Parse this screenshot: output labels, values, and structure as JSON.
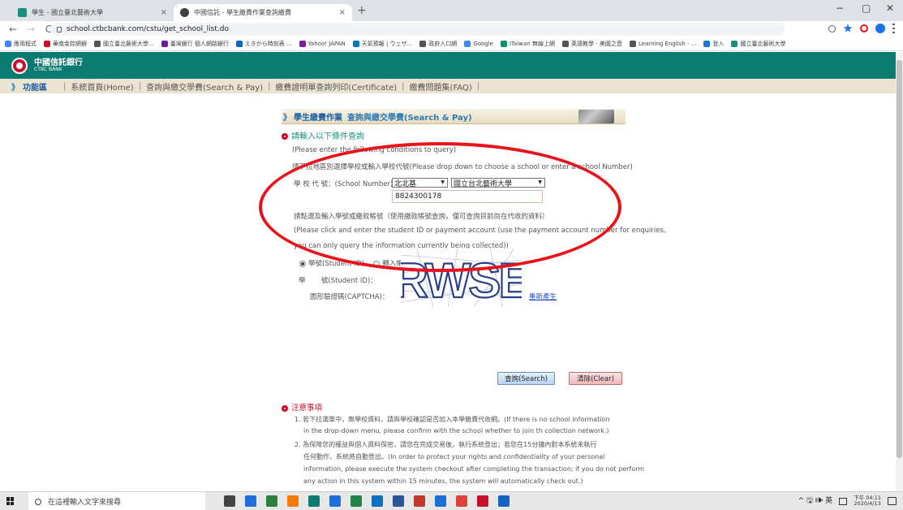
{
  "browser": {
    "tabs": [
      {
        "title": "學生 - 國立臺北藝術大學",
        "close": "×",
        "favicon_color": "#1a8f7a"
      },
      {
        "title": "中國信託 - 學生繳費作業查詢繳費",
        "close": "×",
        "favicon_color": "#3c4043"
      }
    ],
    "new_tab": "+",
    "window_controls": {
      "minimize": "−",
      "maximize": "▢",
      "close": "✕"
    },
    "nav": {
      "back": "←",
      "forward": "→",
      "reload": "C"
    },
    "url": "school.ctbcbank.com/cstu/get_school_list.do",
    "bookmarks": [
      {
        "label": "應用程式",
        "color": "#4285f4"
      },
      {
        "label": "華南金控網銀",
        "color": "#c8102e"
      },
      {
        "label": "國立臺北藝術大學...",
        "color": "#555555"
      },
      {
        "label": "臺灣銀行 個人網路銀行",
        "color": "#6a1b9a"
      },
      {
        "label": "えきから時刻表 ...",
        "color": "#1565c0"
      },
      {
        "label": "Yahoo! JAPAN",
        "color": "#7b1fa2"
      },
      {
        "label": "天氣預報 | ウェザ...",
        "color": "#0277bd"
      },
      {
        "label": "政府入口網",
        "color": "#555555"
      },
      {
        "label": "Google",
        "color": "#4285f4"
      },
      {
        "label": "iTaiwan 無線上網",
        "color": "#0a8f6f"
      },
      {
        "label": "英語教學 - 美國之音",
        "color": "#555555"
      },
      {
        "label": "Learning English - ...",
        "color": "#555555"
      },
      {
        "label": "登入",
        "color": "#1976d2"
      },
      {
        "label": "國立臺北藝術大學",
        "color": "#1a8f7a"
      }
    ],
    "more": "»"
  },
  "bank": {
    "name_cn": "中國信託銀行",
    "name_en": "CTBC BANK",
    "brand_color": "#0b7a70"
  },
  "menu": {
    "arrow": "》",
    "title": "功能區",
    "items": [
      "系統首頁(Home)",
      "查詢與繳交學費(Search & Pay)",
      "繳費證明單查詢列印(Certificate)",
      "繳費問題集(FAQ)"
    ],
    "separator": "|"
  },
  "panel": {
    "arrow": "》",
    "title": "學生繳費作業",
    "subtitle": "查詢與繳交學費(Search & Pay)",
    "section1_heading": "請輸入以下條件查詢",
    "section1_en": "(Please enter the following conditions to query)",
    "section1_instruction": "請下拉地區別選擇學校或輸入學校代號(Please drop down to choose a school or enter a school Number)",
    "school_number_label": "學 校 代 號：(School Number)",
    "region_select": "北北基",
    "school_select": "國立台北藝術大學",
    "school_number_value": "8824300178",
    "section2_instruction": "請點選及輸入學號或繳款帳號（使用繳款帳號查詢，僅可查詢目前尚在代收的資料）",
    "section2_en1": "(Please click and enter the student ID or payment account (use the payment account number for enquiries,",
    "section2_en2": "you can only query the information currently being collected))",
    "radio_student": "學號(Student ID)",
    "radio_account": "轉入帳號(payment account)",
    "student_id_label_a": "學",
    "student_id_label_b": "號(Student ID)：",
    "student_id_value": "",
    "captcha_label": "圖形驗證碼(CAPTCHA)：",
    "captcha_value": "",
    "regenerate": "重新產生",
    "captcha_text": "RWSE",
    "search_button": "查詢(Search)",
    "clear_button": "清除(Clear)"
  },
  "notes": {
    "heading": "注意事項",
    "items": [
      "1. 若下拉選單中，無學校資料，請與學校確認是否加入本學雜費代收網。(If there is no school information",
      "in the drop-down menu, please confirm with the school whether to join th collection network.)",
      "2. 為保障您的權益與個人資料保密，請您在完成交易後，執行系統登出；若您在15分鐘內對本系統未執行",
      "任何動作，系統將自動登出。(In order to protect your rights and confidentiality of your personal",
      "information, please execute the system checkout after completing the transaction; if you do not perform",
      "any action in this system within 15 minutes, the system will automatically check out.)"
    ]
  },
  "taskbar": {
    "search_placeholder": "在這裡輸入文字來搜尋",
    "tray_icons": "^ 🖫 🕪 英",
    "ime": "英",
    "time": "下午 04:11",
    "date": "2020/4/13",
    "pinned_colors": [
      "#444444",
      "#1e6fd9",
      "#2c7f3f",
      "#f57c00",
      "#0b7a70",
      "#1e6fd9",
      "#1e8449",
      "#0b72c2",
      "#2b579a",
      "#c0392b",
      "#1e6fd9",
      "#db4437",
      "#c8102e",
      "#1565c0"
    ]
  },
  "annotation": {
    "color": "#e8131b"
  }
}
